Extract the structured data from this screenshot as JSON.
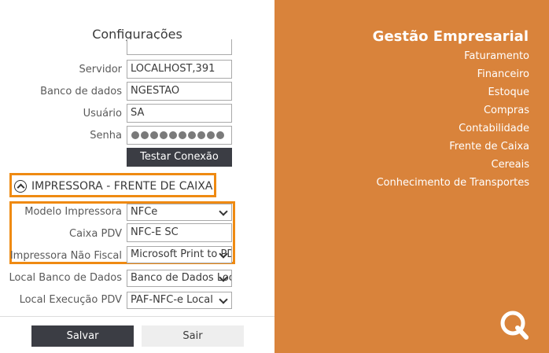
{
  "config": {
    "title": "Configurações",
    "servidor": {
      "label": "Servidor",
      "value": "LOCALHOST,391"
    },
    "banco": {
      "label": "Banco de dados",
      "value": "NGESTAO"
    },
    "usuario": {
      "label": "Usuário",
      "value": "SA"
    },
    "senha": {
      "label": "Senha"
    },
    "test_button": "Testar Conexão",
    "section_title": "IMPRESSORA - FRENTE DE CAIXA",
    "modelo": {
      "label": "Modelo Impressora",
      "value": "NFCe"
    },
    "caixa": {
      "label": "Caixa PDV",
      "value": "NFC-E SC"
    },
    "impressora": {
      "label": "Impressora Não Fiscal",
      "value": "Microsoft Print to PDF"
    },
    "local_banco": {
      "label": "Local Banco de Dados",
      "value": "Banco de Dados Local"
    },
    "local_exec": {
      "label": "Local Execução PDV",
      "value": "PAF-NFC-e Local"
    },
    "save_button": "Salvar",
    "exit_button": "Sair"
  },
  "brand": {
    "title": "Gestão Empresarial",
    "menu": [
      "Faturamento",
      "Financeiro",
      "Estoque",
      "Compras",
      "Contabilidade",
      "Frente de Caixa",
      "Cereais",
      "Conhecimento de Transportes"
    ],
    "accent_color": "#d9833b",
    "highlight_color": "#ef8a12"
  }
}
